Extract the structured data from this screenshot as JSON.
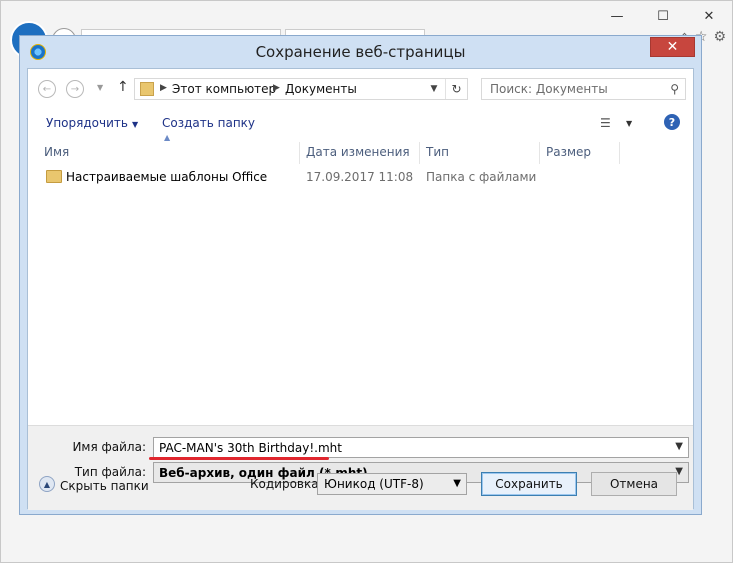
{
  "dialog": {
    "title": "Сохранение веб-страницы",
    "close_label": "✕"
  },
  "nav": {
    "breadcrumb": [
      "Этот компьютер",
      "Документы"
    ],
    "search_placeholder": "Поиск: Документы"
  },
  "commands": {
    "organize": "Упорядочить",
    "new_folder": "Создать папку"
  },
  "columns": [
    "Имя",
    "Дата изменения",
    "Тип",
    "Размер"
  ],
  "rows": [
    {
      "name": "Настраиваемые шаблоны Office",
      "date": "17.09.2017 11:08",
      "type": "Папка с файлами",
      "size": ""
    }
  ],
  "form": {
    "filename_label": "Имя файла:",
    "filename_value": "PAC-MAN's 30th Birthday!.mht",
    "filetype_label": "Тип файла:",
    "filetype_value": "Веб-архив, один файл (*.mht)"
  },
  "footer": {
    "hide_folders": "Скрыть папки",
    "encoding_label": "Кодировка:",
    "encoding_value": "Юникод (UTF-8)",
    "save": "Сохранить",
    "cancel": "Отмена"
  },
  "colors": {
    "accent": "#2e62b4",
    "highlight_underline": "#e0262e",
    "close": "#c7463e"
  }
}
